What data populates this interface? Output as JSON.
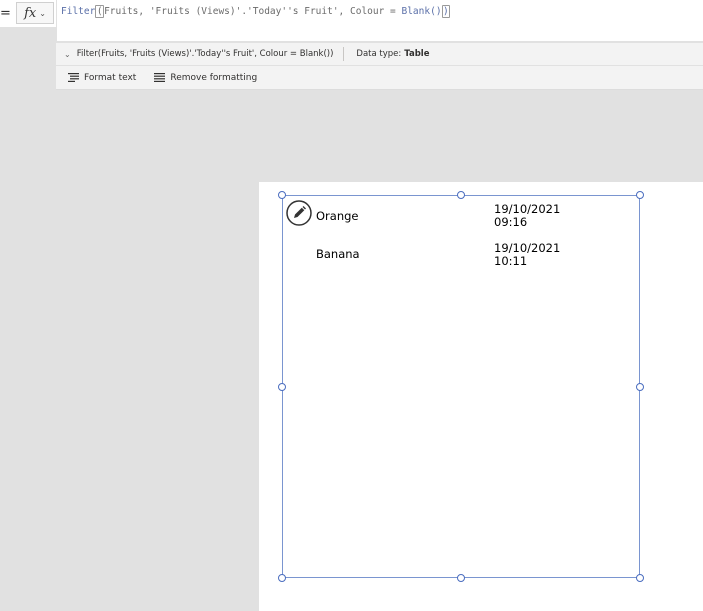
{
  "formula_bar": {
    "equals": "=",
    "fx_label": "fx",
    "fx_chevron": "⌄",
    "formula": {
      "fn": "Filter",
      "open_paren": "(",
      "body": "Fruits, 'Fruits (Views)'.'Today''s Fruit', Colour = ",
      "blank_fn": "Blank",
      "inner_parens": "()",
      "close_paren": ")"
    }
  },
  "info_bar": {
    "chevron": "⌄",
    "formula_preview": "Filter(Fruits, 'Fruits (Views)'.'Today''s Fruit', Colour = Blank())",
    "data_type_label": "Data type:",
    "data_type_value": "Table"
  },
  "toolbar": {
    "format_text_label": "Format text",
    "remove_formatting_label": "Remove formatting",
    "format_text_icon": "format-text-icon",
    "remove_formatting_icon": "remove-formatting-icon"
  },
  "gallery": {
    "edit_icon": "pencil-icon",
    "rows": [
      {
        "name": "Orange",
        "date": "19/10/2021",
        "time": "09:16"
      },
      {
        "name": "Banana",
        "date": "19/10/2021",
        "time": "10:11"
      }
    ]
  },
  "colors": {
    "selection": "#7a95d0",
    "handle": "#4a6dbf",
    "function_token": "#5a6fa8",
    "workspace": "#e1e1e1"
  }
}
